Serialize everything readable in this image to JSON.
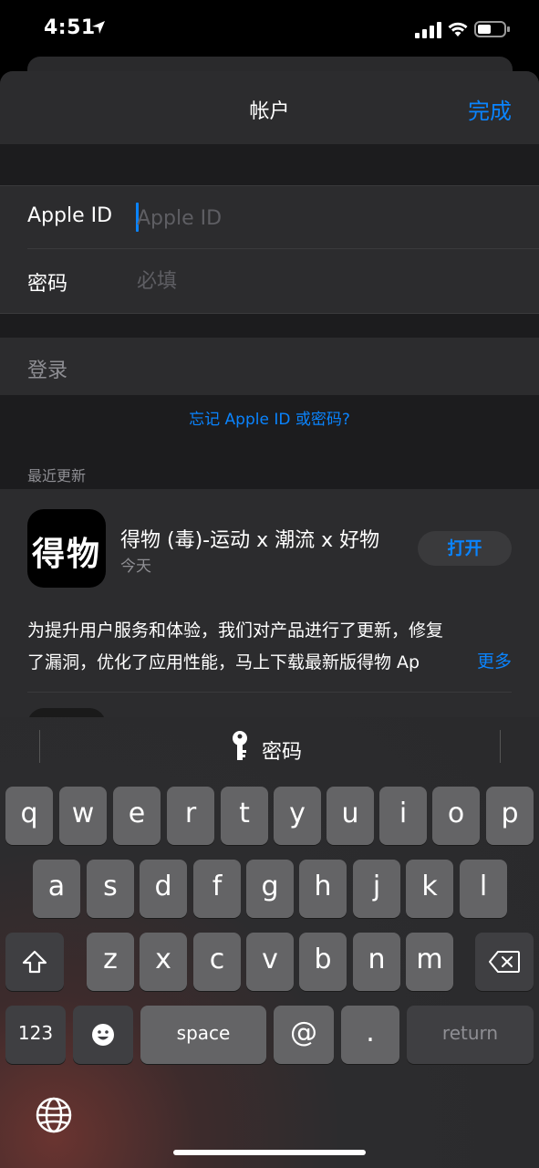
{
  "status": {
    "time": "4:51"
  },
  "nav": {
    "title": "帐户",
    "done": "完成"
  },
  "form": {
    "apple_id_label": "Apple ID",
    "apple_id_placeholder": "Apple ID",
    "password_label": "密码",
    "password_placeholder": "必填"
  },
  "signin": "登录",
  "forgot": "忘记 Apple ID 或密码?",
  "recent": {
    "header": "最近更新",
    "app": {
      "icon_text": "得物",
      "name": "得物 (毒)-运动 x 潮流 x 好物",
      "date": "今天",
      "open": "打开",
      "desc_line1": "为提升用户服务和体验，我们对产品进行了更新，修复",
      "desc_line2": "了漏洞，优化了应用性能，马上下载最新版得物 Ap",
      "more": "更多"
    }
  },
  "keyboard": {
    "suggestion": "密码",
    "row1": [
      "q",
      "w",
      "e",
      "r",
      "t",
      "y",
      "u",
      "i",
      "o",
      "p"
    ],
    "row2": [
      "a",
      "s",
      "d",
      "f",
      "g",
      "h",
      "j",
      "k",
      "l"
    ],
    "row3": [
      "z",
      "x",
      "c",
      "v",
      "b",
      "n",
      "m"
    ],
    "num": "123",
    "space": "space",
    "at": "@",
    "dot": ".",
    "return": "return"
  }
}
